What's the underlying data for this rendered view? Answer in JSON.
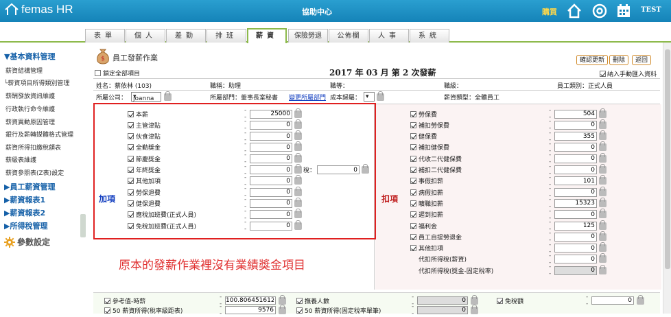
{
  "app": {
    "logo": "femas HR",
    "center_title": "協助中心",
    "buy": "購買",
    "user": "TEST"
  },
  "colors": {
    "brand": "#1a8fc6",
    "tab_active": "#8cb94a",
    "sidebar_group": "#1560a8",
    "annotation": "#e03030",
    "redbox": "#e02020"
  },
  "tabs": [
    {
      "label": "表單"
    },
    {
      "label": "個人"
    },
    {
      "label": "差勤"
    },
    {
      "label": "排班"
    },
    {
      "label": "薪資"
    },
    {
      "label": "保險勞退"
    },
    {
      "label": "公佈欄"
    },
    {
      "label": "人事"
    },
    {
      "label": "系統"
    }
  ],
  "sidebar": {
    "groups": [
      {
        "label": "▼基本資料管理"
      },
      {
        "label": "▶員工薪資管理"
      },
      {
        "label": "▶薪資報表1"
      },
      {
        "label": "▶薪資報表2"
      },
      {
        "label": "▶所得稅管理"
      }
    ],
    "items": [
      {
        "label": "薪資結構管理"
      },
      {
        "label": "└薪資項目所得類別管理"
      },
      {
        "label": "薪酬發放資訊維護"
      },
      {
        "label": "行政執行命令維護"
      },
      {
        "label": "薪資異動原因管理"
      },
      {
        "label": "銀行及薪轉媒體格式管理"
      },
      {
        "label": "薪資所得扣繳稅額表"
      },
      {
        "label": "薪級表維護"
      },
      {
        "label": "薪資參照表(Z表)設定"
      }
    ],
    "param": "參數設定"
  },
  "page": {
    "title": "員工發薪作業",
    "lock_all": "鎖定全部項目",
    "header": "2017 年 03 月  第 2 次發薪",
    "manual_import": "納入手動匯入資料",
    "buttons": {
      "confirm": "確認更新",
      "delete": "刪除",
      "back": "返回"
    }
  },
  "info": {
    "name": "姓名：蔡依林 (103)",
    "title": "職稱：助理",
    "rank": "職等：",
    "grade": "職級：",
    "category": "員工類別：正式人員",
    "company_label": "所屬公司：",
    "company": "joanna",
    "dept": "所屬部門：董事長室秘書",
    "change_dept": "變更所屬部門",
    "cost_label": "成本歸屬：",
    "salary_type": "薪資類型：全體員工"
  },
  "additions": {
    "label": "加項",
    "tax_label": "稅：",
    "tax_value": "0",
    "items": [
      {
        "name": "本薪",
        "value": "25000"
      },
      {
        "name": "主管津貼",
        "value": "0"
      },
      {
        "name": "伙食津貼",
        "value": "0"
      },
      {
        "name": "全勤獎金",
        "value": "0"
      },
      {
        "name": "節慶獎金",
        "value": "0"
      },
      {
        "name": "年終獎金",
        "value": "0"
      },
      {
        "name": "其他加項",
        "value": "0"
      },
      {
        "name": "勞保退費",
        "value": "0"
      },
      {
        "name": "健保退費",
        "value": "0"
      },
      {
        "name": "應稅加班費(正式人員)",
        "value": "0"
      },
      {
        "name": "免稅加班費(正式人員)",
        "value": "0"
      }
    ]
  },
  "deductions": {
    "label": "扣項",
    "items": [
      {
        "name": "勞保費",
        "value": "504"
      },
      {
        "name": "補扣勞保費",
        "value": "0"
      },
      {
        "name": "健保費",
        "value": "355"
      },
      {
        "name": "補扣健保費",
        "value": "0"
      },
      {
        "name": "代收二代健保費",
        "value": "0"
      },
      {
        "name": "補扣二代健保費",
        "value": "0"
      },
      {
        "name": "事假扣薪",
        "value": "101"
      },
      {
        "name": "病假扣薪",
        "value": "0"
      },
      {
        "name": "曠職扣薪",
        "value": "15323"
      },
      {
        "name": "遲到扣薪",
        "value": "0"
      },
      {
        "name": "福利金",
        "value": "125"
      },
      {
        "name": "員工自提勞退金",
        "value": "0"
      },
      {
        "name": "其他扣項",
        "value": "0"
      }
    ],
    "withhold": [
      {
        "name": "代扣所得稅(薪資)",
        "value": "0"
      },
      {
        "name": "代扣所得稅(獎金-固定稅率)",
        "value": "0"
      }
    ]
  },
  "annotation": "原本的發薪作業裡沒有業績獎金項目",
  "bottom": {
    "items": [
      {
        "name": "參考值-時薪",
        "value": "100.806451612"
      },
      {
        "name": "撫養人數",
        "value": "0"
      },
      {
        "name": "免稅額",
        "value": "0"
      },
      {
        "name": "50 薪資所得(稅率級距表)",
        "value": "9576"
      },
      {
        "name": "50 薪資所得(固定稅率單筆)",
        "value": "0"
      }
    ]
  }
}
